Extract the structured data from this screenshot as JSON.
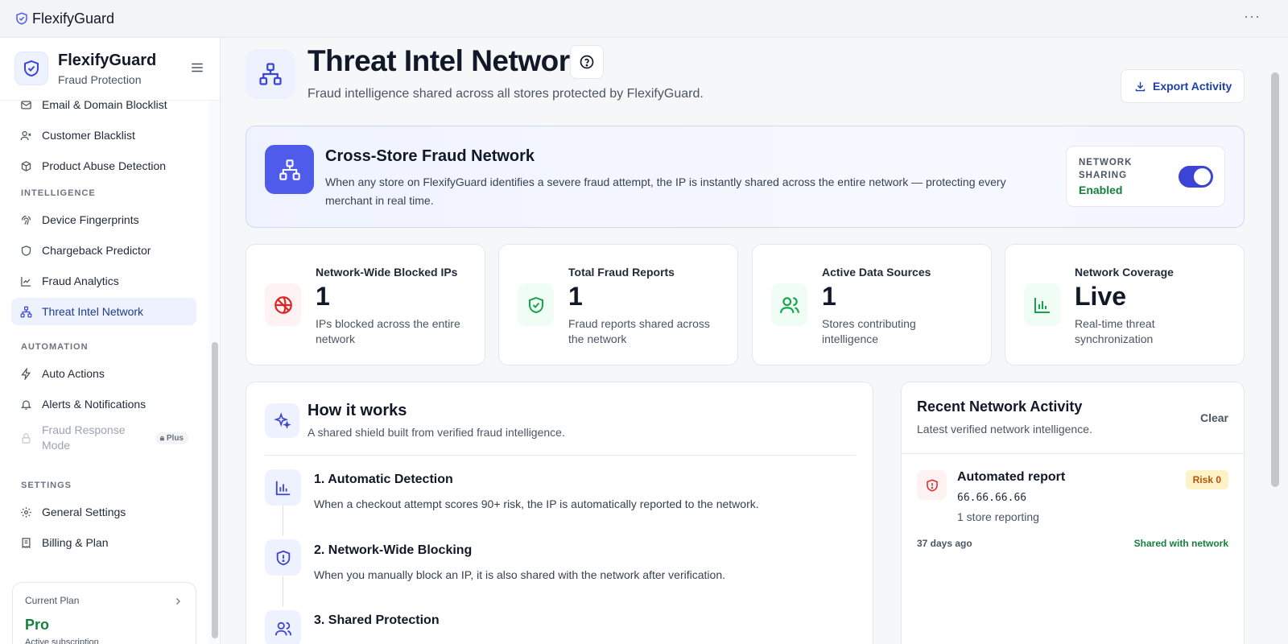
{
  "app": {
    "title": "FlexifyGuard",
    "menu_icon": "more-horizontal-icon"
  },
  "sidebar": {
    "brand_title": "FlexifyGuard",
    "brand_subtitle": "Fraud Protection",
    "items_top": [
      {
        "label": "Email & Domain Blocklist",
        "icon": "mail-icon"
      },
      {
        "label": "Customer Blacklist",
        "icon": "user-x-icon"
      },
      {
        "label": "Product Abuse Detection",
        "icon": "package-icon"
      }
    ],
    "section_intelligence": "INTELLIGENCE",
    "items_intelligence": [
      {
        "label": "Device Fingerprints",
        "icon": "fingerprint-icon"
      },
      {
        "label": "Chargeback Predictor",
        "icon": "shield-icon"
      },
      {
        "label": "Fraud Analytics",
        "icon": "line-chart-icon"
      },
      {
        "label": "Threat Intel Network",
        "icon": "network-icon",
        "active": true
      }
    ],
    "section_automation": "AUTOMATION",
    "items_automation": [
      {
        "label": "Auto Actions",
        "icon": "zap-icon"
      },
      {
        "label": "Alerts & Notifications",
        "icon": "bell-icon"
      },
      {
        "label": "Fraud Response Mode",
        "icon": "lock-icon",
        "badge": "Plus",
        "disabled": true
      }
    ],
    "section_settings": "SETTINGS",
    "items_settings": [
      {
        "label": "General Settings",
        "icon": "gear-icon"
      },
      {
        "label": "Billing & Plan",
        "icon": "receipt-icon"
      }
    ],
    "plan": {
      "label": "Current Plan",
      "name": "Pro",
      "status": "Active subscription"
    }
  },
  "page": {
    "title": "Threat Intel Network",
    "subtitle": "Fraud intelligence shared across all stores protected by FlexifyGuard.",
    "export_label": "Export Activity"
  },
  "banner": {
    "title": "Cross-Store Fraud Network",
    "description": "When any store on FlexifyGuard identifies a severe fraud attempt, the IP is instantly shared across the entire network — protecting every merchant in real time.",
    "sharing_label": "NETWORK SHARING",
    "sharing_value": "Enabled",
    "sharing_on": true
  },
  "stats": [
    {
      "label": "Network-Wide Blocked IPs",
      "value": "1",
      "desc": "IPs blocked across the entire network",
      "icon": "globe-ban-icon",
      "color": "#dc2626"
    },
    {
      "label": "Total Fraud Reports",
      "value": "1",
      "desc": "Fraud reports shared across the network",
      "icon": "shield-check-icon",
      "color": "#16a34a"
    },
    {
      "label": "Active Data Sources",
      "value": "1",
      "desc": "Stores contributing intelligence",
      "icon": "users-icon",
      "color": "#16a34a"
    },
    {
      "label": "Network Coverage",
      "value": "Live",
      "desc": "Real-time threat synchronization",
      "icon": "bar-chart-icon",
      "color": "#16a34a"
    }
  ],
  "how": {
    "title": "How it works",
    "subtitle": "A shared shield built from verified fraud intelligence.",
    "steps": [
      {
        "title": "1. Automatic Detection",
        "desc": "When a checkout attempt scores 90+ risk, the IP is automatically reported to the network."
      },
      {
        "title": "2. Network-Wide Blocking",
        "desc": "When you manually block an IP, it is also shared with the network after verification."
      },
      {
        "title": "3. Shared Protection",
        "desc": ""
      }
    ]
  },
  "activity": {
    "title": "Recent Network Activity",
    "subtitle": "Latest verified network intelligence.",
    "clear_label": "Clear",
    "items": [
      {
        "title": "Automated report",
        "ip": "66.66.66.66",
        "count": "1 store reporting",
        "risk": "Risk 0",
        "time": "37 days ago",
        "status": "Shared with network"
      }
    ]
  },
  "colors": {
    "accent": "#4f5bea",
    "success": "#15803d",
    "danger": "#dc2626",
    "nav_active_bg": "#eef2ff"
  }
}
